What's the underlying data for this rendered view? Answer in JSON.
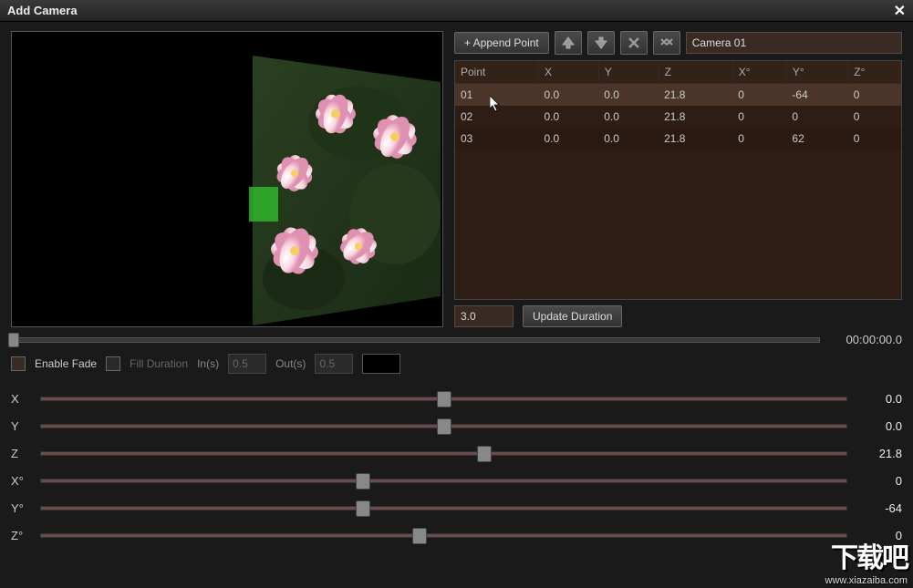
{
  "window": {
    "title": "Add Camera"
  },
  "toolbar": {
    "append_label": "+ Append Point",
    "camera_value": "Camera 01",
    "update_label": "Update Duration",
    "duration_value": "3.0"
  },
  "table": {
    "headers": [
      "Point",
      "X",
      "Y",
      "Z",
      "X°",
      "Y°",
      "Z°"
    ],
    "rows": [
      {
        "point": "01",
        "x": "0.0",
        "y": "0.0",
        "z": "21.8",
        "xd": "0",
        "yd": "-64",
        "zd": "0",
        "selected": true
      },
      {
        "point": "02",
        "x": "0.0",
        "y": "0.0",
        "z": "21.8",
        "xd": "0",
        "yd": "0",
        "zd": "0",
        "selected": false
      },
      {
        "point": "03",
        "x": "0.0",
        "y": "0.0",
        "z": "21.8",
        "xd": "0",
        "yd": "62",
        "zd": "0",
        "selected": false
      }
    ]
  },
  "timeline": {
    "timecode": "00:00:00.0"
  },
  "fade": {
    "enable_label": "Enable Fade",
    "fill_label": "Fill Duration",
    "in_label": "In(s)",
    "in_value": "0.5",
    "out_label": "Out(s)",
    "out_value": "0.5"
  },
  "sliders": [
    {
      "label": "X",
      "value": "0.0",
      "pos": 50
    },
    {
      "label": "Y",
      "value": "0.0",
      "pos": 50
    },
    {
      "label": "Z",
      "value": "21.8",
      "pos": 55
    },
    {
      "label": "X°",
      "value": "0",
      "pos": 40
    },
    {
      "label": "Y°",
      "value": "-64",
      "pos": 40
    },
    {
      "label": "Z°",
      "value": "0",
      "pos": 47
    }
  ],
  "watermark": {
    "big": "下载吧",
    "url": "www.xiazaiba.com"
  }
}
